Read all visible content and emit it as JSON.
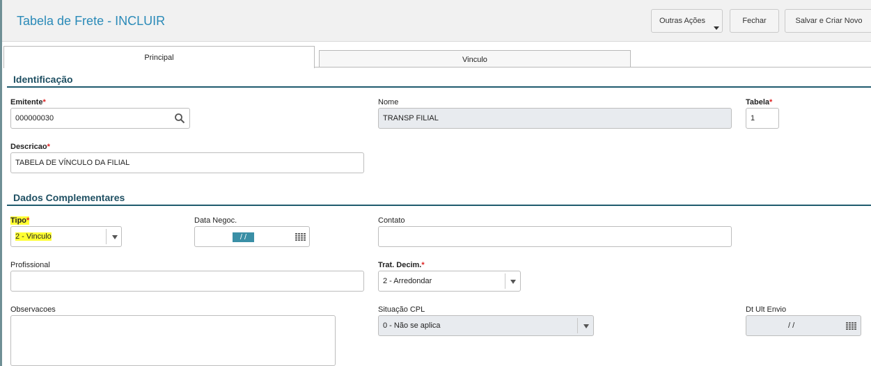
{
  "header": {
    "title": "Tabela de Frete - INCLUIR",
    "buttons": {
      "outras": "Outras Ações",
      "fechar": "Fechar",
      "salvar": "Salvar e Criar Novo"
    }
  },
  "tabs": [
    {
      "label": "Principal",
      "active": true
    },
    {
      "label": "Vinculo",
      "active": false
    }
  ],
  "identificacao": {
    "title": "Identificação",
    "emitente": {
      "label": "Emitente",
      "value": "000000030"
    },
    "nome": {
      "label": "Nome",
      "value": "TRANSP FILIAL"
    },
    "tabela": {
      "label": "Tabela",
      "value": "1"
    },
    "descricao": {
      "label": "Descricao",
      "value": "TABELA DE VÍNCULO DA FILIAL"
    }
  },
  "complementares": {
    "title": "Dados Complementares",
    "tipo": {
      "label": "Tipo",
      "value": "2 - Vinculo"
    },
    "data_negoc": {
      "label": "Data Negoc.",
      "value": "/ /"
    },
    "contato": {
      "label": "Contato",
      "value": ""
    },
    "profissional": {
      "label": "Profissional",
      "value": ""
    },
    "trat_decim": {
      "label": "Trat. Decim.",
      "value": "2 - Arredondar"
    },
    "observacoes": {
      "label": "Observacoes",
      "value": ""
    },
    "situacao_cpl": {
      "label": "Situação CPL",
      "value": "0 - Não se aplica"
    },
    "dt_ult_envio": {
      "label": "Dt Ult Envio",
      "value": "/ /"
    }
  },
  "required_marker": "*",
  "colors": {
    "title": "#2a8ab8",
    "section": "#1e4f62",
    "required": "#dd2222",
    "highlight": "#ffff33",
    "readonly_bg": "#e8ebef"
  },
  "icons": {
    "search": "search-icon",
    "calendar": "calendar-icon",
    "dropdown": "chevron-down-icon"
  }
}
